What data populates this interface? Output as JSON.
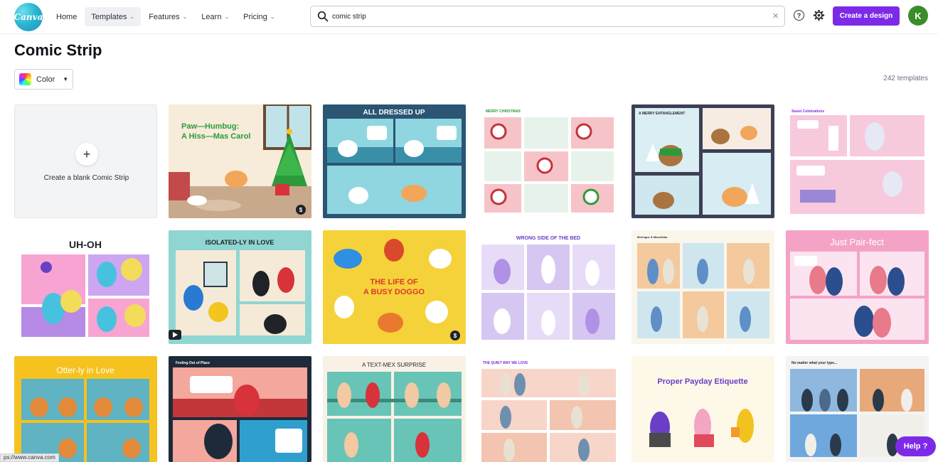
{
  "logo": {
    "text": "Canva"
  },
  "nav": {
    "home": "Home",
    "templates": "Templates",
    "features": "Features",
    "learn": "Learn",
    "pricing": "Pricing"
  },
  "search": {
    "value": "comic strip"
  },
  "header": {
    "help_icon": "?",
    "create_label": "Create a design",
    "avatar_initial": "K"
  },
  "page": {
    "title": "Comic Strip",
    "color_filter": "Color",
    "template_count": "242 templates"
  },
  "blank": {
    "plus": "+",
    "label": "Create a blank Comic Strip"
  },
  "templates": [
    {
      "title": "Paw—Humbug:",
      "subtitle": "A Hiss—Mas Carol",
      "badge": "$"
    },
    {
      "title": "ALL DRESSED UP"
    },
    {
      "title": "MERRY CHRISTMAS"
    },
    {
      "title": "A MERRY ENTANGLEMENT"
    },
    {
      "title": "Sweet Celebrations"
    },
    {
      "title": "UH-OH"
    },
    {
      "title": "ISOLATED-LY IN LOVE"
    },
    {
      "title": "THE LIFE OF",
      "subtitle": "A BUSY DOGGO",
      "badge": "$"
    },
    {
      "title": "WRONG SIDE OF THE BED"
    },
    {
      "title": "Meringue & Macchiato"
    },
    {
      "title": "Just Pair-fect"
    },
    {
      "title": "Otter-ly in Love"
    },
    {
      "title": "Feeling Out of Place"
    },
    {
      "title": "A TEXT-MEX SURPRISE"
    },
    {
      "title": "THE QUIET WAY WE LOVE"
    },
    {
      "title": "Proper Payday Etiquette"
    },
    {
      "title": "No matter what your type..."
    }
  ],
  "status_bar": {
    "url": "ps://www.canva.com"
  },
  "help": {
    "label": "Help ?"
  },
  "colors": {
    "accent": "#7d2ae8",
    "avatar": "#3a8d2b"
  }
}
